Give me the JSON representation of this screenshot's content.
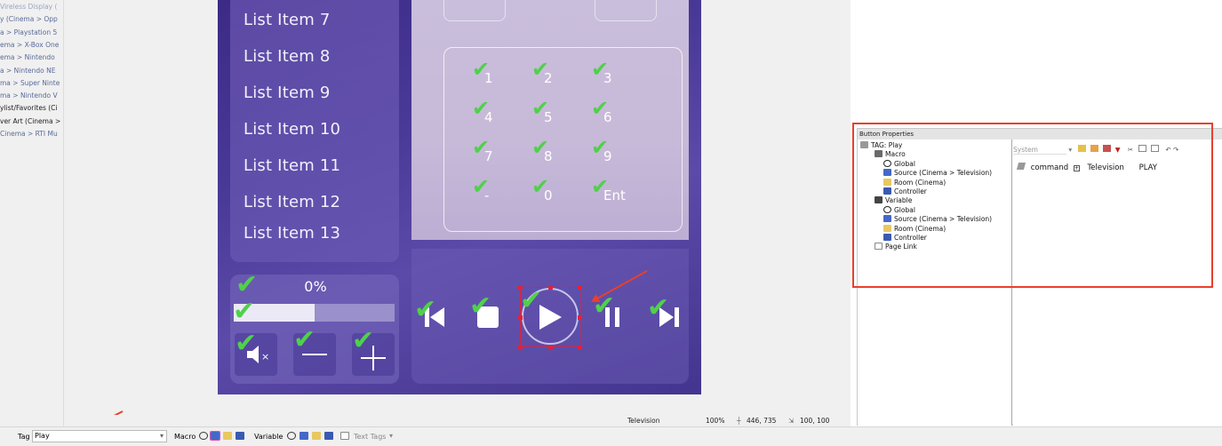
{
  "left_list": [
    {
      "text": "Vireless Display (",
      "style": "dim"
    },
    {
      "text": "y (Cinema > Opp",
      "style": "normal"
    },
    {
      "text": "a > Playstation 5",
      "style": "normal"
    },
    {
      "text": "ema > X-Box One",
      "style": "normal"
    },
    {
      "text": "ema > Nintendo",
      "style": "normal"
    },
    {
      "text": "a > Nintendo NE",
      "style": "normal"
    },
    {
      "text": "ma > Super Ninte",
      "style": "normal"
    },
    {
      "text": "ma > Nintendo V",
      "style": "normal"
    },
    {
      "text": "ylist/Favorites (Ci",
      "style": "bold"
    },
    {
      "text": "ver Art (Cinema >",
      "style": "bold"
    },
    {
      "text": "Cinema > RTI Mu",
      "style": "normal"
    }
  ],
  "design": {
    "list_items": [
      "List Item 7",
      "List Item 8",
      "List Item 9",
      "List Item 10",
      "List Item 11",
      "List Item 12",
      "List Item 13"
    ],
    "keypad": [
      "1",
      "2",
      "3",
      "4",
      "5",
      "6",
      "7",
      "8",
      "9",
      "-",
      "0",
      "Ent"
    ],
    "progress_label": "0%",
    "progress_fill_fraction": 0.5,
    "volume_icons": [
      "mute-icon",
      "minus-icon",
      "plus-icon"
    ],
    "transport_icons": [
      "skip-back-icon",
      "stop-icon",
      "play-icon",
      "pause-icon",
      "skip-forward-icon"
    ],
    "check_color": "#4fd14a",
    "selection_color": "#e0223a"
  },
  "button_properties": {
    "title": "Button Properties",
    "tree": [
      {
        "label": "TAG: Play",
        "indent": 0,
        "icon": "tag-icon"
      },
      {
        "label": "Macro",
        "indent": 1,
        "icon": "macro-icon"
      },
      {
        "label": "Global",
        "indent": 2,
        "icon": "globe-icon"
      },
      {
        "label": "Source (Cinema > Television)",
        "indent": 2,
        "icon": "source-icon"
      },
      {
        "label": "Room (Cinema)",
        "indent": 2,
        "icon": "room-icon"
      },
      {
        "label": "Controller",
        "indent": 2,
        "icon": "controller-icon"
      },
      {
        "label": "Variable",
        "indent": 1,
        "icon": "variable-icon"
      },
      {
        "label": "Global",
        "indent": 2,
        "icon": "globe-icon"
      },
      {
        "label": "Source (Cinema > Television)",
        "indent": 2,
        "icon": "source-icon"
      },
      {
        "label": "Room (Cinema)",
        "indent": 2,
        "icon": "room-icon"
      },
      {
        "label": "Controller",
        "indent": 2,
        "icon": "controller-icon"
      },
      {
        "label": "Page Link",
        "indent": 1,
        "icon": "page-icon"
      }
    ],
    "toolbar_system": "System",
    "command": {
      "type": "command",
      "device": "Television",
      "action": "PLAY"
    }
  },
  "status_bar": {
    "device": "Television",
    "zoom": "100%",
    "position": "446, 735",
    "size": "100, 100"
  },
  "bottom_bar": {
    "tag_label": "Tag",
    "tag_value": "Play",
    "macro_label": "Macro",
    "variable_label": "Variable",
    "text_tags_label": "Text Tags"
  }
}
